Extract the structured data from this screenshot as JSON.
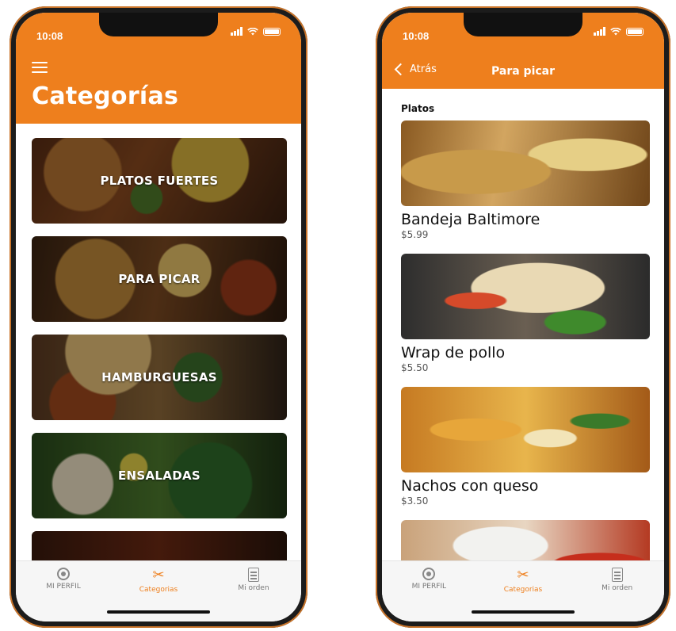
{
  "colors": {
    "accent": "#ee7f1d",
    "tab_inactive": "#777777"
  },
  "status_bar": {
    "time": "10:08"
  },
  "left_screen": {
    "title": "Categorías",
    "categories": [
      {
        "label": "PLATOS FUERTES"
      },
      {
        "label": "PARA PICAR"
      },
      {
        "label": "HAMBURGUESAS"
      },
      {
        "label": "ENSALADAS"
      },
      {
        "label": ""
      }
    ]
  },
  "right_screen": {
    "back_label": "Atrás",
    "title": "Para picar",
    "section": "Platos",
    "dishes": [
      {
        "name": "Bandeja Baltimore",
        "price": "$5.99"
      },
      {
        "name": "Wrap de pollo",
        "price": "$5.50"
      },
      {
        "name": "Nachos con queso",
        "price": "$3.50"
      },
      {
        "name": "",
        "price": ""
      }
    ]
  },
  "tabbar": {
    "items": [
      {
        "label": "MI PERFIL",
        "icon": "profile-icon"
      },
      {
        "label": "Categorias",
        "icon": "categories-icon"
      },
      {
        "label": "Mi orden",
        "icon": "order-icon"
      }
    ]
  }
}
